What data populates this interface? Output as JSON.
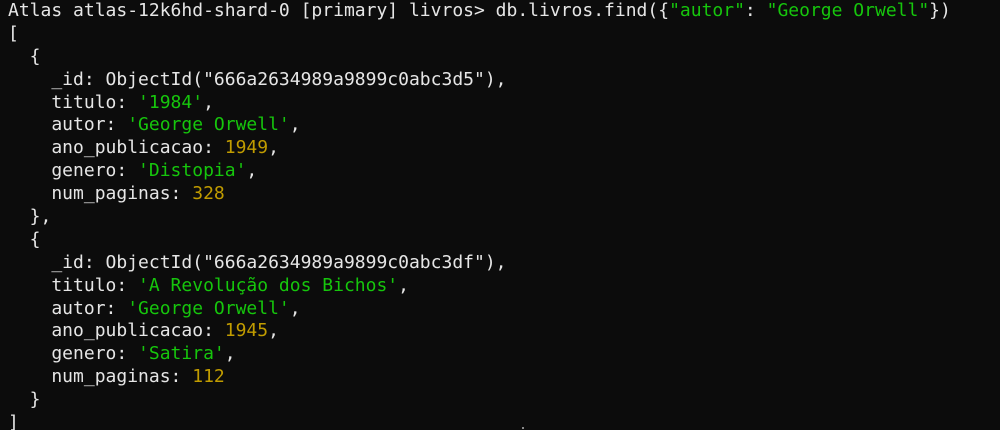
{
  "prompt": {
    "text": "Atlas atlas-12k6hd-shard-0 [primary] livros> ",
    "command_prefix": "db.livros.find({",
    "query_key": "\"autor\"",
    "query_sep": ": ",
    "query_value": "\"George Orwell\"",
    "command_suffix": "})"
  },
  "output": {
    "open_bracket": "[",
    "close_bracket": "]",
    "documents": [
      {
        "open": "  {",
        "id_line": "    _id: ObjectId(\"666a2634989a9899c0abc3d5\"),",
        "titulo_key": "    titulo: ",
        "titulo_value": "'1984'",
        "autor_key": "    autor: ",
        "autor_value": "'George Orwell'",
        "ano_key": "    ano_publicacao: ",
        "ano_value": "1949",
        "genero_key": "    genero: ",
        "genero_value": "'Distopia'",
        "paginas_key": "    num_paginas: ",
        "paginas_value": "328",
        "close": "  },"
      },
      {
        "open": "  {",
        "id_line": "    _id: ObjectId(\"666a2634989a9899c0abc3df\"),",
        "titulo_key": "    titulo: ",
        "titulo_value": "'A Revolução dos Bichos'",
        "autor_key": "    autor: ",
        "autor_value": "'George Orwell'",
        "ano_key": "    ano_publicacao: ",
        "ano_value": "1945",
        "genero_key": "    genero: ",
        "genero_value": "'Satira'",
        "paginas_key": "    num_paginas: ",
        "paginas_value": "112",
        "close": "  }"
      }
    ],
    "comma": ","
  },
  "colors": {
    "background": "#0c0c0c",
    "text": "#e6e6e6",
    "string": "#16c60c",
    "number": "#c19c00"
  }
}
